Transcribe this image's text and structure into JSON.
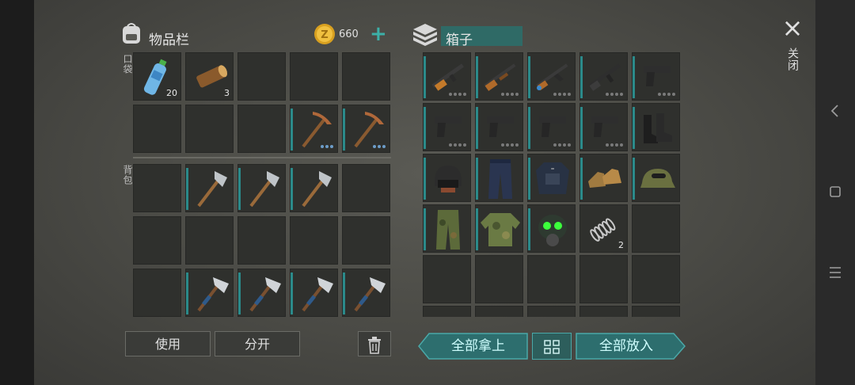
{
  "inventory": {
    "title": "物品栏",
    "coins": "660",
    "add_symbol": "+",
    "pocket_label": "口袋",
    "backpack_label": "背包",
    "pocket_items": [
      {
        "name": "water-bottle",
        "qty": "20"
      },
      {
        "name": "wood-log",
        "qty": "3"
      },
      {
        "name": "pickaxe",
        "dots": true
      },
      {
        "name": "pickaxe",
        "dots": true
      }
    ],
    "use_label": "使用",
    "split_label": "分开"
  },
  "box": {
    "title": "箱子",
    "spring_qty": "2",
    "take_all_label": "全部拿上",
    "put_all_label": "全部放入"
  },
  "close": {
    "icon": "×",
    "label": "关闭"
  },
  "colors": {
    "accent": "#2b8a8a",
    "teal_button": "#2d6e6e",
    "coin": "#e0b030"
  }
}
